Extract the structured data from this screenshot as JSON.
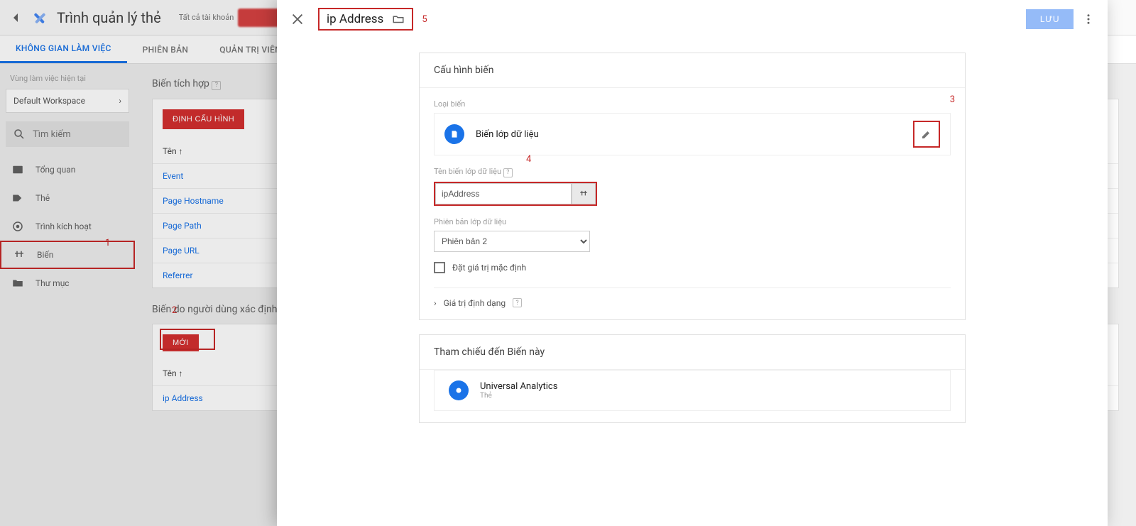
{
  "header": {
    "app_title": "Trình quản lý thẻ",
    "account_label": "Tất cả tài khoản"
  },
  "tabs": [
    "KHÔNG GIAN LÀM VIỆC",
    "PHIÊN BẢN",
    "QUẢN TRỊ VIÊN"
  ],
  "sidebar": {
    "hint": "Vùng làm việc hiện tại",
    "workspace": "Default Workspace",
    "search_placeholder": "Tìm kiếm",
    "items": [
      {
        "label": "Tổng quan"
      },
      {
        "label": "Thẻ"
      },
      {
        "label": "Trình kích hoạt"
      },
      {
        "label": "Biến"
      },
      {
        "label": "Thư mục"
      }
    ]
  },
  "content": {
    "builtin_title": "Biến tích hợp",
    "configure_btn": "ĐỊNH CẤU HÌNH",
    "name_header": "Tên ↑",
    "builtin_rows": [
      "Event",
      "Page Hostname",
      "Page Path",
      "Page URL",
      "Referrer"
    ],
    "user_title": "Biến do người dùng xác định",
    "new_btn": "MỚI",
    "user_rows": [
      "ip Address"
    ]
  },
  "drawer": {
    "title": "ip Address",
    "save_btn": "LƯU",
    "config_title": "Cấu hình biến",
    "type_label": "Loại biến",
    "type_value": "Biến lớp dữ liệu",
    "dl_name_label": "Tên biến lớp dữ liệu",
    "dl_name_value": "ipAddress",
    "version_label": "Phiên bản lớp dữ liệu",
    "version_value": "Phiên bản 2",
    "default_cb": "Đặt giá trị mặc định",
    "format_label": "Giá trị định dạng",
    "refs_title": "Tham chiếu đến Biến này",
    "ref_name": "Universal Analytics",
    "ref_sub": "Thẻ"
  },
  "annotations": {
    "1": "1",
    "2": "2",
    "3": "3",
    "4": "4",
    "5": "5"
  }
}
